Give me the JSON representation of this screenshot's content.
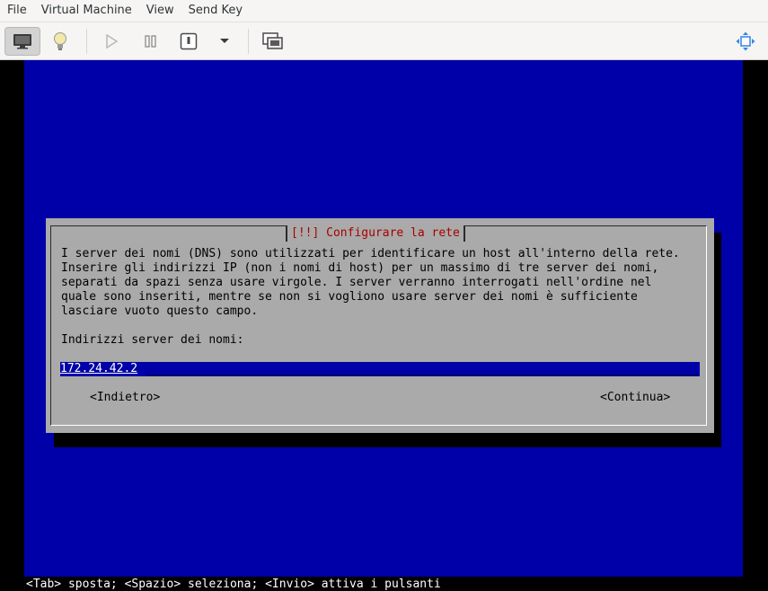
{
  "menubar": {
    "items": [
      "File",
      "Virtual Machine",
      "View",
      "Send Key"
    ]
  },
  "toolbar": {
    "buttons": [
      {
        "icon": "monitor-icon",
        "active": true
      },
      {
        "icon": "lightbulb-icon",
        "active": false
      },
      {
        "icon": "play-icon",
        "active": false
      },
      {
        "icon": "pause-icon",
        "active": false
      },
      {
        "icon": "power-icon",
        "active": false
      },
      {
        "icon": "chevron-down-icon",
        "active": false
      },
      {
        "icon": "snapshot-icon",
        "active": false
      },
      {
        "icon": "fullscreen-icon",
        "active": false
      }
    ]
  },
  "installer": {
    "title": "[!!] Configurare la rete",
    "description": [
      "I server dei nomi (DNS) sono utilizzati per identificare un host all'interno della rete.",
      "Inserire gli indirizzi IP (non i nomi di host) per un massimo di tre server dei nomi,",
      "separati da spazi senza usare virgole. I server verranno interrogati nell'ordine nel",
      "quale sono inseriti, mentre se non si vogliono usare server dei nomi è sufficiente",
      "lasciare vuoto questo campo."
    ],
    "field_label": "Indirizzi server dei nomi:",
    "field_value": "172.24.42.2",
    "back_button": "<Indietro>",
    "continue_button": "<Continua>",
    "status_line": "<Tab> sposta; <Spazio> seleziona; <Invio> attiva i pulsanti"
  },
  "colors": {
    "console_blue": "#0000a8",
    "dialog_gray": "#aaaaaa",
    "title_red": "#a80000"
  }
}
